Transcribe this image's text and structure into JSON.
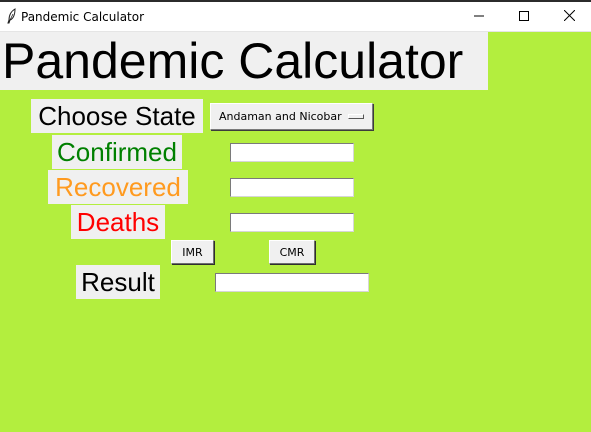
{
  "window": {
    "title": "Pandemic Calculator",
    "icons": {
      "app": "feather-icon",
      "minimize": "minimize-icon",
      "maximize": "maximize-icon",
      "close": "close-icon"
    }
  },
  "main": {
    "heading": "Pandemic Calculator",
    "state": {
      "label": "Choose State",
      "selected": "Andaman and Nicobar"
    },
    "confirmed": {
      "label": "Confirmed",
      "value": ""
    },
    "recovered": {
      "label": "Recovered",
      "value": ""
    },
    "deaths": {
      "label": "Deaths",
      "value": ""
    },
    "buttons": {
      "imr": "IMR",
      "cmr": "CMR"
    },
    "result": {
      "label": "Result",
      "value": ""
    }
  },
  "colors": {
    "background": "#b3ee3e",
    "label_bg": "#f0f0f0",
    "confirmed": "#008000",
    "recovered": "#ff9a1f",
    "deaths": "#ff0000"
  }
}
